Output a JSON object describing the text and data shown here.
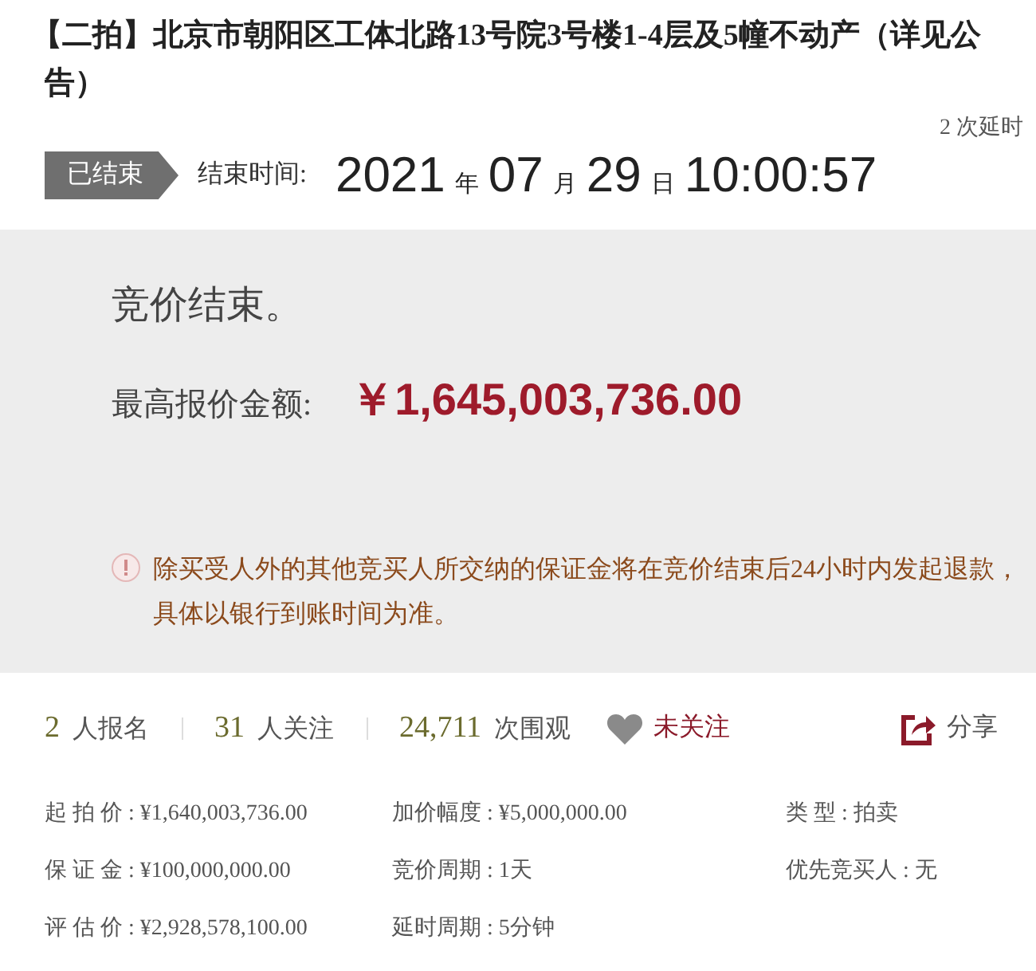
{
  "title": {
    "tag": "【二拍】",
    "text": "北京市朝阳区工体北路13号院3号楼1-4层及5幢不动产（详见公告）"
  },
  "extensions": "2 次延时",
  "status": {
    "badge": "已结束",
    "label": "结束时间:",
    "parts": [
      {
        "kind": "num",
        "text": "2021"
      },
      {
        "kind": "unit",
        "text": "年"
      },
      {
        "kind": "num",
        "text": "07"
      },
      {
        "kind": "unit",
        "text": "月"
      },
      {
        "kind": "num",
        "text": "29"
      },
      {
        "kind": "unit",
        "text": "日"
      },
      {
        "kind": "num",
        "text": "10:00:57"
      }
    ]
  },
  "result": {
    "message": "竞价结束。",
    "price_label": "最高报价金额:",
    "price": "￥1,645,003,736.00",
    "notice": "除买受人外的其他竞买人所交纳的保证金将在竞价结束后24小时内发起退款，具体以银行到账时间为准。"
  },
  "stats": [
    {
      "count": "2",
      "label": "人报名"
    },
    {
      "count": "31",
      "label": "人关注"
    },
    {
      "count": "24,711",
      "label": "次围观"
    }
  ],
  "follow": {
    "label": "未关注",
    "followed": false
  },
  "share": "分享",
  "details": [
    {
      "label": "起 拍 价 :",
      "value": "¥1,640,003,736.00"
    },
    {
      "label": "加价幅度 :",
      "value": "¥5,000,000.00"
    },
    {
      "label": "类 型 :",
      "value": "拍卖"
    },
    {
      "label": "保 证 金 :",
      "value": "¥100,000,000.00"
    },
    {
      "label": "竞价周期 :",
      "value": "1天"
    },
    {
      "label": "优先竞买人 :",
      "value": "无"
    },
    {
      "label": "评 估 价 :",
      "value": "¥2,928,578,100.00"
    },
    {
      "label": "延时周期 :",
      "value": "5分钟"
    }
  ]
}
